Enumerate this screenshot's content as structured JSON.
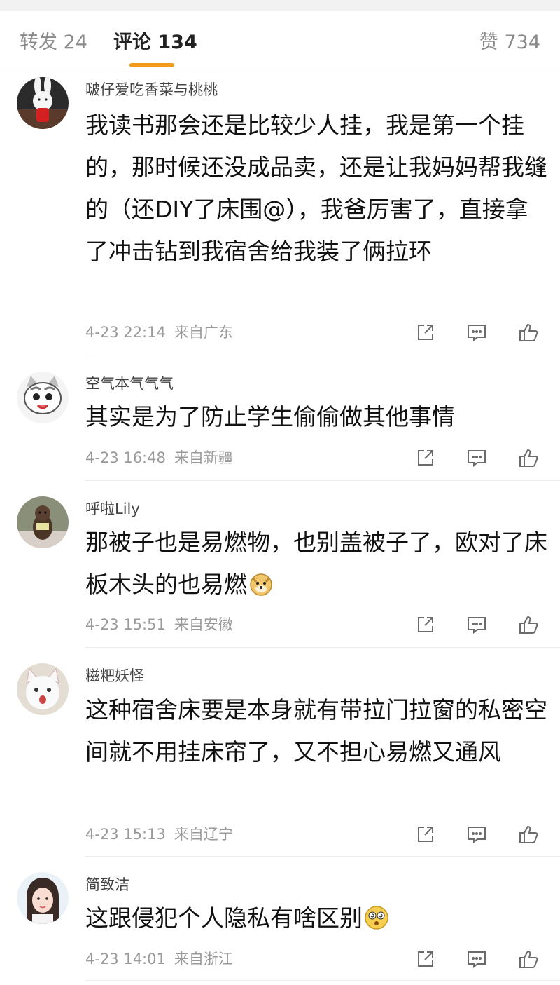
{
  "tabs": {
    "repost_label": "转发 24",
    "comments_label": "评论 134",
    "likes_label": "赞 734"
  },
  "colors": {
    "accent": "#f39a1b",
    "meta_text": "#9a9a9a",
    "divider": "#ededed"
  },
  "comments": [
    {
      "user": "啵仔爱吃香菜与桃桃",
      "text": "我读书那会还是比较少人挂，我是第一个挂的，那时候还没成品卖，还是让我妈妈帮我缝的（还DIY了床围@），我爸厉害了，直接拿了冲击钻到我宿舍给我装了俩拉环",
      "time": "4-23 22:14",
      "location": "来自广东",
      "avatar_icon": "white-rabbit-plush-avatar"
    },
    {
      "user": "空气本气气气",
      "text": "其实是为了防止学生偷偷做其他事情",
      "time": "4-23 16:48",
      "location": "来自新疆",
      "avatar_icon": "cartoon-cat-avatar"
    },
    {
      "user": "呼啦Lily",
      "text": "那被子也是易燃物，也别盖被子了，欧对了床板木头的也易燃",
      "time": "4-23 15:51",
      "location": "来自安徽",
      "avatar_icon": "small-dog-avatar",
      "emoji": "doge-emoji"
    },
    {
      "user": "糍粑妖怪",
      "text": "这种宿舍床要是本身就有带拉门拉窗的私密空间就不用挂床帘了，又不担心易燃又通风",
      "time": "4-23 15:13",
      "location": "来自辽宁",
      "avatar_icon": "white-kitten-avatar"
    },
    {
      "user": "简致洁",
      "text": "这跟侵犯个人隐私有啥区别",
      "time": "4-23 14:01",
      "location": "来自浙江",
      "avatar_icon": "girl-portrait-avatar",
      "emoji": "dizzy-face-emoji"
    }
  ]
}
